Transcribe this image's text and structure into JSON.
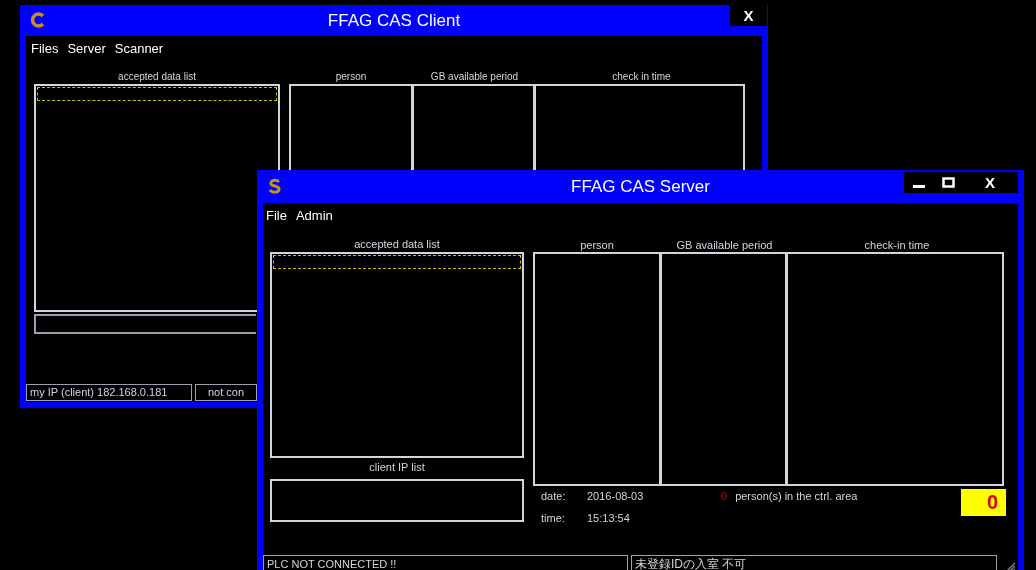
{
  "client_window": {
    "title": "FFAG CAS Client",
    "close": "X",
    "menu": [
      "Files",
      "Server",
      "Scanner"
    ],
    "list_label": "accepted data list",
    "columns": [
      "person",
      "GB available period",
      "check in time"
    ],
    "status_bar": [
      "my IP (client) 182.168.0.181",
      "not con"
    ]
  },
  "server_window": {
    "title": "FFAG CAS Server",
    "close": "X",
    "menu": [
      "File",
      "Admin"
    ],
    "list_label": "accepted data list",
    "client_ip_label": "client IP list",
    "columns": [
      "person",
      "GB available period",
      "check-in time"
    ],
    "date_label": "date:",
    "date": "2016-08-03",
    "time_label": "time:",
    "time": "15:13:54",
    "count": "0",
    "count_label": "person(s) in the ctrl. area",
    "big_count": "0",
    "status_bar": [
      "PLC NOT CONNECTED !!",
      "未登録IDの入室 不可"
    ]
  }
}
